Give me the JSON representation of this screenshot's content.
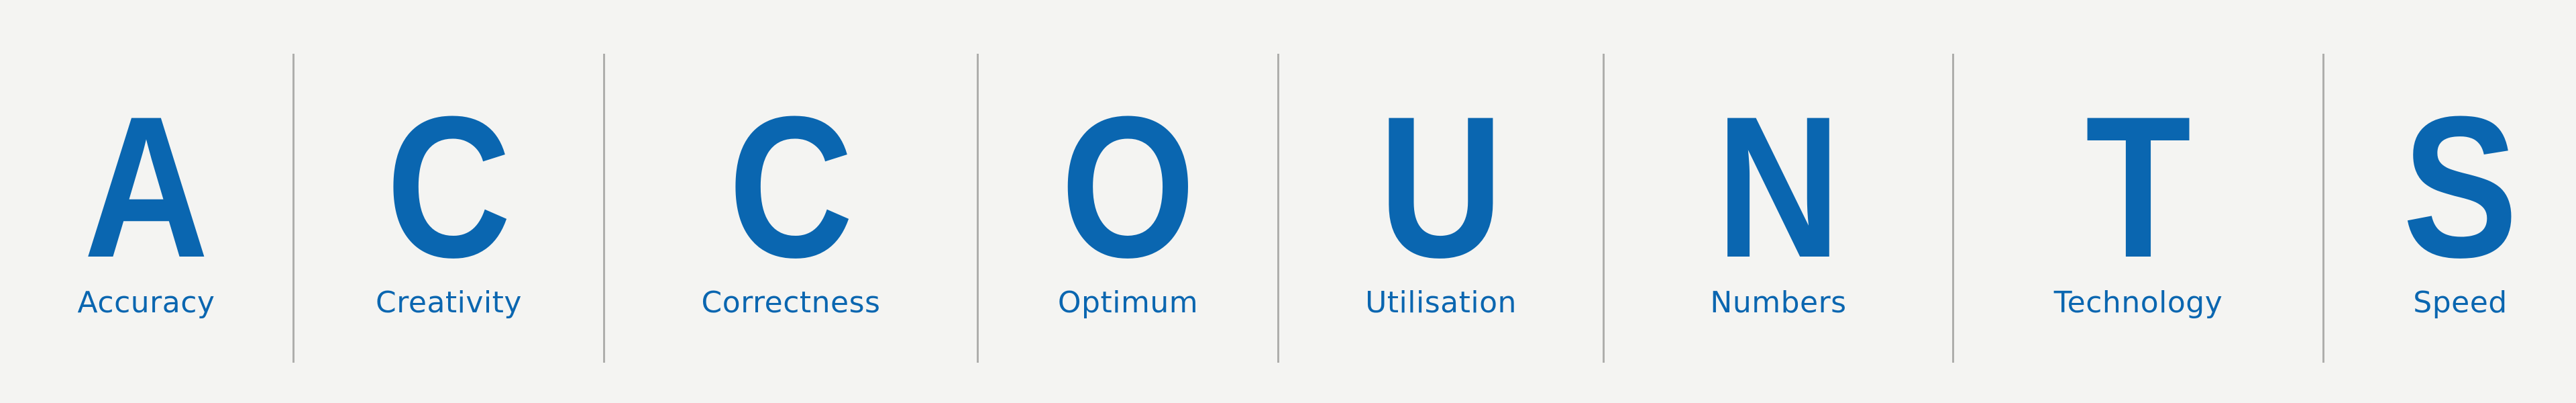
{
  "colors": {
    "background": "#f4f4f2",
    "accent": "#0a66b0",
    "divider": "#aeaeac"
  },
  "items": [
    {
      "letter": "A",
      "label": "Accuracy"
    },
    {
      "letter": "C",
      "label": "Creativity"
    },
    {
      "letter": "C",
      "label": "Correctness"
    },
    {
      "letter": "O",
      "label": "Optimum"
    },
    {
      "letter": "U",
      "label": "Utilisation"
    },
    {
      "letter": "N",
      "label": "Numbers"
    },
    {
      "letter": "T",
      "label": "Technology"
    },
    {
      "letter": "S",
      "label": "Speed"
    }
  ]
}
